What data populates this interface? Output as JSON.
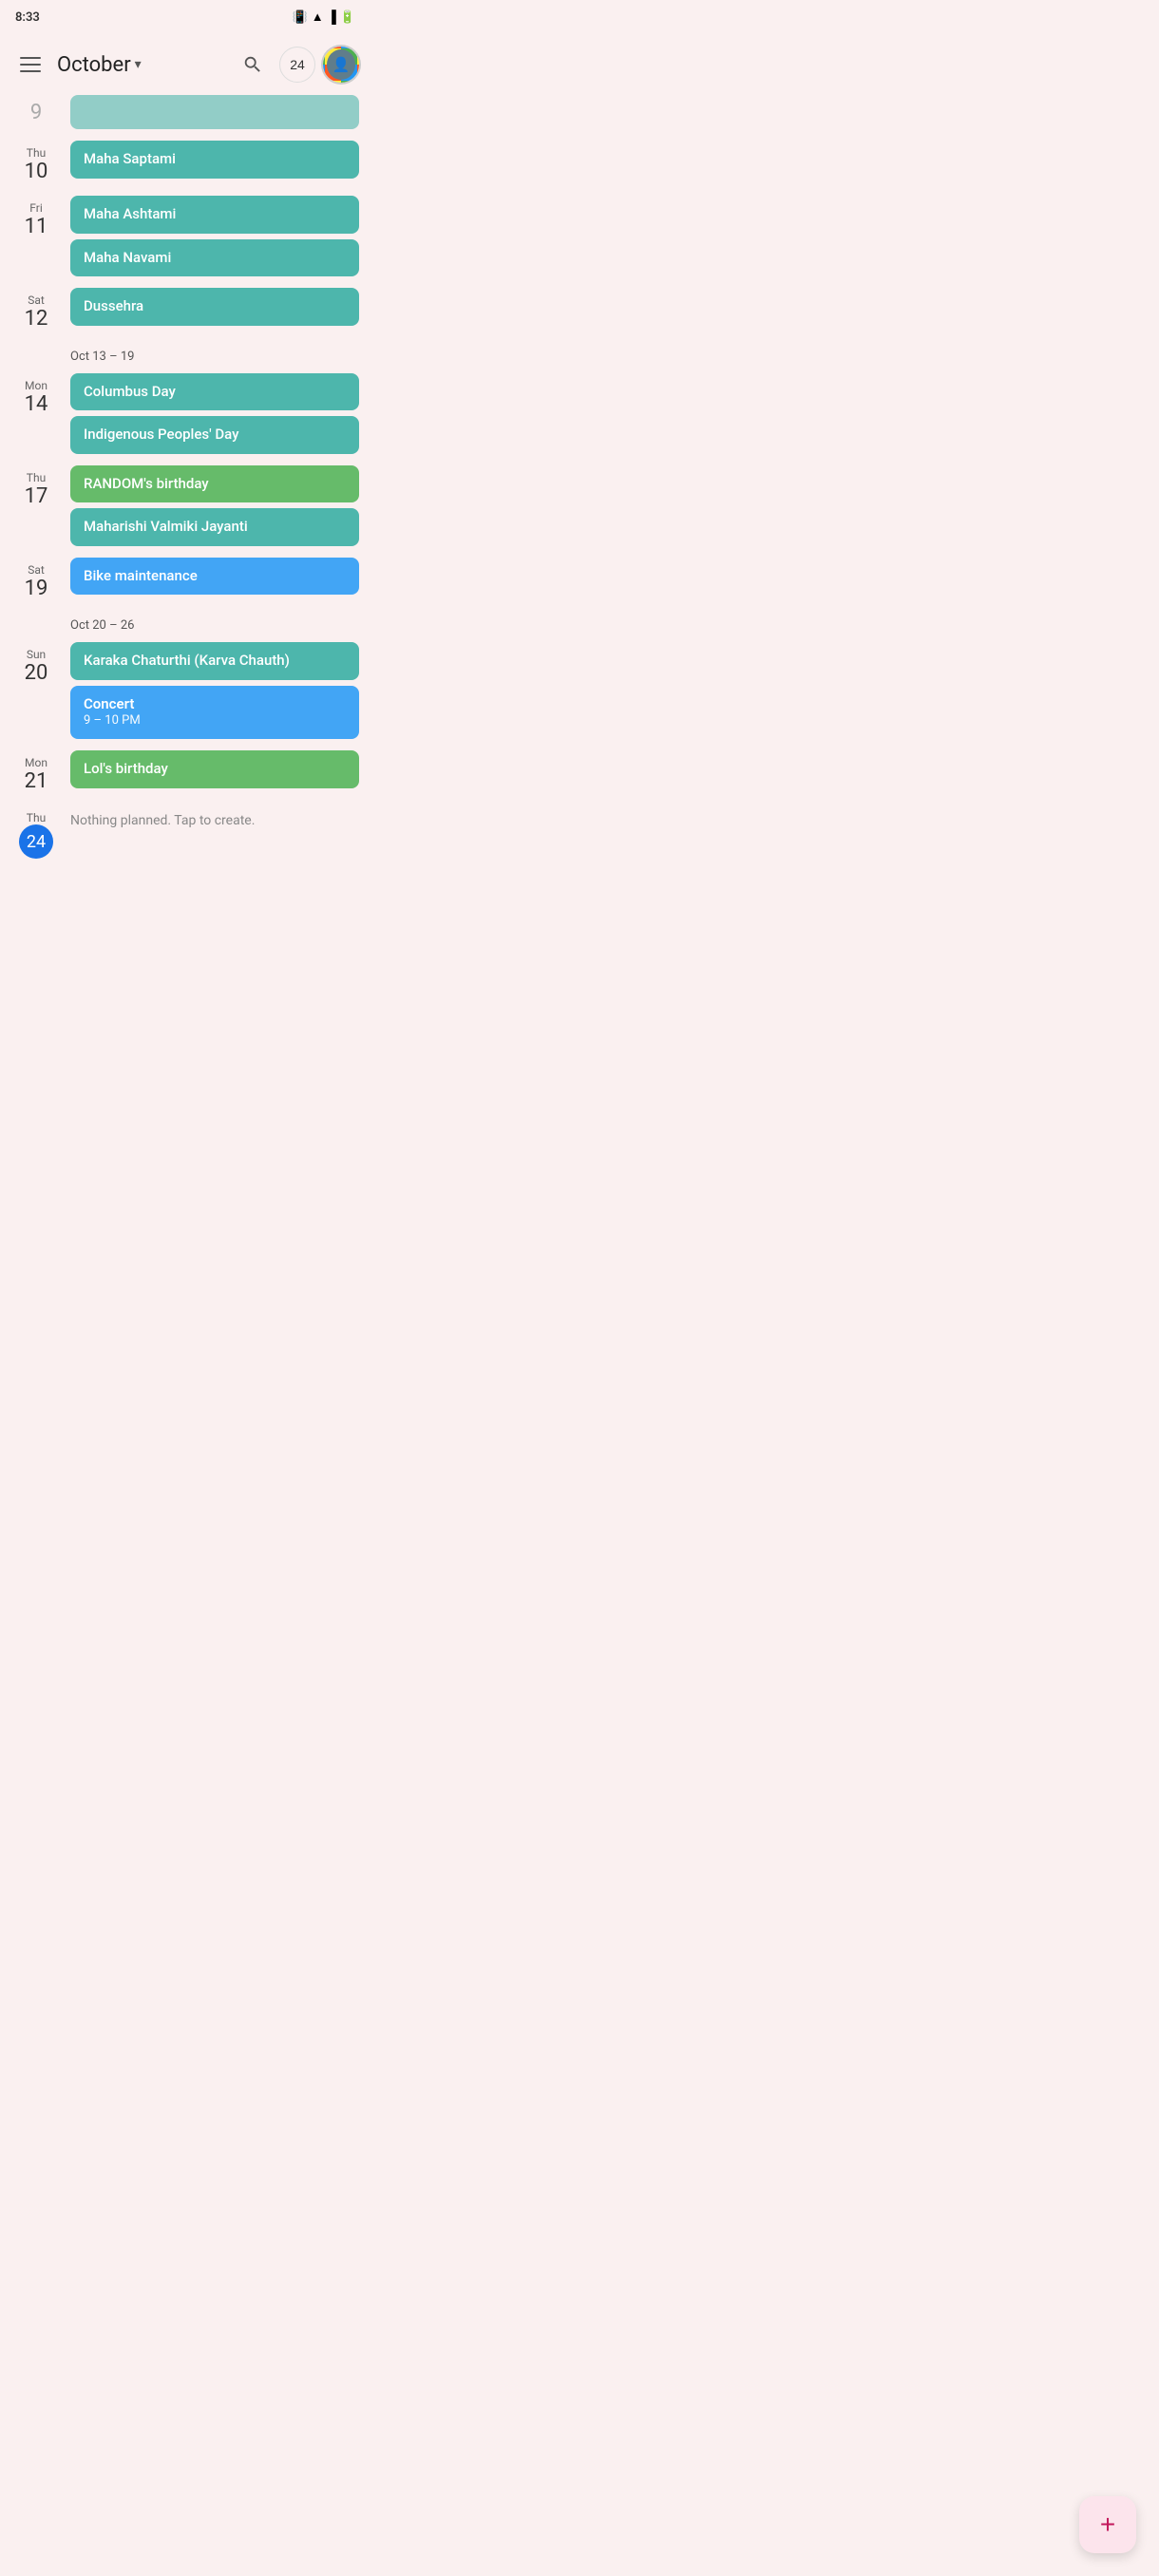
{
  "statusBar": {
    "time": "8:33",
    "icons": [
      "battery",
      "signal",
      "wifi",
      "vibrate"
    ]
  },
  "header": {
    "menuIcon": "menu-icon",
    "title": "October",
    "dropdownIcon": "▾",
    "searchIcon": "search-icon",
    "dateLabel": "24",
    "avatarAlt": "user-avatar"
  },
  "weekSeparators": [
    {
      "id": "sep1",
      "label": "Oct 13 – 19"
    },
    {
      "id": "sep2",
      "label": "Oct 20 – 26"
    }
  ],
  "days": [
    {
      "id": "day-9",
      "dayName": "",
      "dayNum": "9",
      "partial": true,
      "events": [
        {
          "id": "evt-partial-9",
          "title": "",
          "type": "teal",
          "partial": true
        }
      ]
    },
    {
      "id": "day-10",
      "dayName": "Thu",
      "dayNum": "10",
      "events": [
        {
          "id": "evt-maha-saptami",
          "title": "Maha Saptami",
          "type": "teal"
        }
      ]
    },
    {
      "id": "day-11",
      "dayName": "Fri",
      "dayNum": "11",
      "events": [
        {
          "id": "evt-maha-ashtami",
          "title": "Maha Ashtami",
          "type": "teal"
        },
        {
          "id": "evt-maha-navami",
          "title": "Maha Navami",
          "type": "teal"
        }
      ]
    },
    {
      "id": "day-12",
      "dayName": "Sat",
      "dayNum": "12",
      "events": [
        {
          "id": "evt-dussehra",
          "title": "Dussehra",
          "type": "teal"
        }
      ]
    },
    {
      "id": "day-14",
      "dayName": "Mon",
      "dayNum": "14",
      "weekSepBefore": "Oct 13 – 19",
      "events": [
        {
          "id": "evt-columbus-day",
          "title": "Columbus Day",
          "type": "teal"
        },
        {
          "id": "evt-indigenous",
          "title": "Indigenous Peoples' Day",
          "type": "teal"
        }
      ]
    },
    {
      "id": "day-17",
      "dayName": "Thu",
      "dayNum": "17",
      "events": [
        {
          "id": "evt-random-bday",
          "title": "RANDOM's birthday",
          "type": "green"
        },
        {
          "id": "evt-maharishi",
          "title": "Maharishi Valmiki Jayanti",
          "type": "teal"
        }
      ]
    },
    {
      "id": "day-19",
      "dayName": "Sat",
      "dayNum": "19",
      "events": [
        {
          "id": "evt-bike",
          "title": "Bike maintenance",
          "type": "blue"
        }
      ]
    },
    {
      "id": "day-20",
      "dayName": "Sun",
      "dayNum": "20",
      "weekSepBefore": "Oct 20 – 26",
      "events": [
        {
          "id": "evt-karva-chauth",
          "title": "Karaka Chaturthi (Karva Chauth)",
          "type": "teal"
        },
        {
          "id": "evt-concert",
          "title": "Concert",
          "time": "9 – 10 PM",
          "type": "blue-multiline"
        }
      ]
    },
    {
      "id": "day-21",
      "dayName": "Mon",
      "dayNum": "21",
      "events": [
        {
          "id": "evt-lol-bday",
          "title": "Lol's birthday",
          "type": "green"
        }
      ]
    },
    {
      "id": "day-24",
      "dayName": "Thu",
      "dayNum": "24",
      "isToday": true,
      "events": [
        {
          "id": "evt-nothing",
          "title": "Nothing planned. Tap to create.",
          "type": "nothing"
        }
      ]
    }
  ],
  "fab": {
    "icon": "plus-icon",
    "label": "+"
  }
}
